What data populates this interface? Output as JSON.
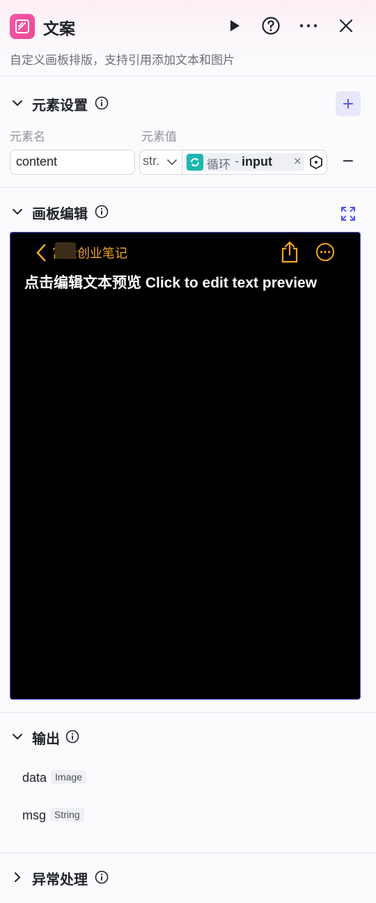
{
  "header": {
    "title": "文案",
    "description": "自定义画板排版，支持引用添加文本和图片",
    "icons": [
      "draw-app-icon",
      "run-icon",
      "help-icon",
      "more-icon",
      "close-icon"
    ]
  },
  "element_settings": {
    "title": "元素设置",
    "col_name": "元素名",
    "col_value": "元素值",
    "add_label": "+",
    "remove_label": "−",
    "row": {
      "name": "content",
      "type": "str.",
      "ref_node": "循环",
      "ref_dot": "-",
      "ref_var": "input",
      "ref_close": "×"
    }
  },
  "canvas_editor": {
    "title": "画板编辑",
    "nav_title": "富贵创业笔记",
    "preview_text": "点击编辑文本预览 Click to edit text preview",
    "accent": "#f5a623"
  },
  "output": {
    "title": "输出",
    "items": [
      {
        "name": "data",
        "type": "Image"
      },
      {
        "name": "msg",
        "type": "String"
      }
    ]
  },
  "exception": {
    "title": "异常处理"
  },
  "colors": {
    "brand": "#4d53e8",
    "app_icon": "#f857a6",
    "loop_icon": "#1cb7b0"
  }
}
